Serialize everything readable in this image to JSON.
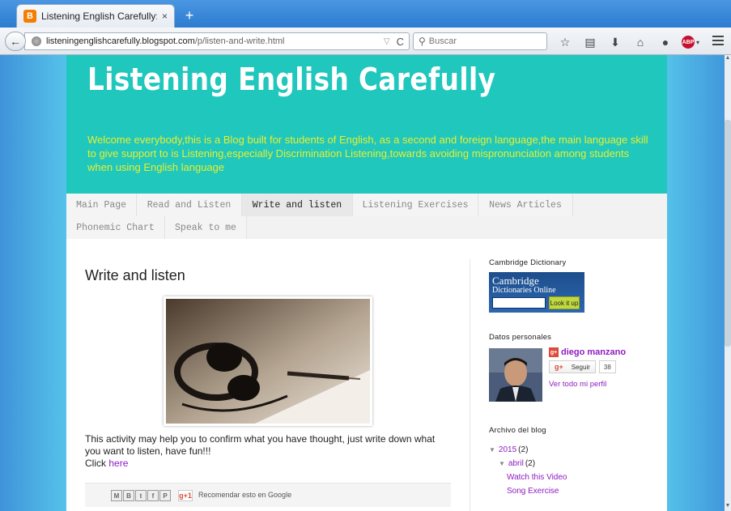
{
  "browser": {
    "tab_title": "Listening English Carefully: W...",
    "tab_close": "×",
    "new_tab": "+",
    "url_host": "listeningenglishcarefully.blogspot.com",
    "url_path": "/p/listen-and-write.html",
    "search_placeholder": "Buscar",
    "abp_label": "ABP"
  },
  "blog": {
    "title": "Listening English Carefully",
    "description": "Welcome everybody,this is a Blog built for students of English, as a second and foreign language,the main language skill to give support to is Listening,especially Discrimination Listening,towards avoiding mispronunciation among students when using English language",
    "tabs_row1": [
      "Main Page",
      "Read and Listen",
      "Write and listen",
      "Listening Exercises",
      "News Articles"
    ],
    "tabs_row2": [
      "Phonemic Chart",
      "Speak to me"
    ],
    "active_tab": "Write and listen"
  },
  "post": {
    "title": "Write and listen",
    "body": "This activity may help you to confirm what you have thought, just write down what you want to listen, have fun!!!",
    "click_label": "Click",
    "link_label": "here",
    "share_gplus": "g+1",
    "recommend_text": "Recomendar esto en Google"
  },
  "sidebar": {
    "cambridge_title": "Cambridge Dictionary",
    "cambridge_line1": "Cambridge",
    "cambridge_line2": "Dictionaries Online",
    "cambridge_button": "Look it up",
    "profile_title": "Datos personales",
    "profile_name": "diego manzano",
    "follow_label": "Seguir",
    "follow_count": "38",
    "profile_link": "Ver todo mi perfil",
    "archive_title": "Archivo del blog",
    "archive": {
      "year": "2015",
      "year_count": "(2)",
      "month": "abril",
      "month_count": "(2)",
      "posts": [
        "Watch this Video",
        "Song Exercise"
      ]
    }
  },
  "colors": {
    "header_bg": "#20c7bd",
    "description_text": "#e7ef2e",
    "link": "#8e1cc0"
  }
}
